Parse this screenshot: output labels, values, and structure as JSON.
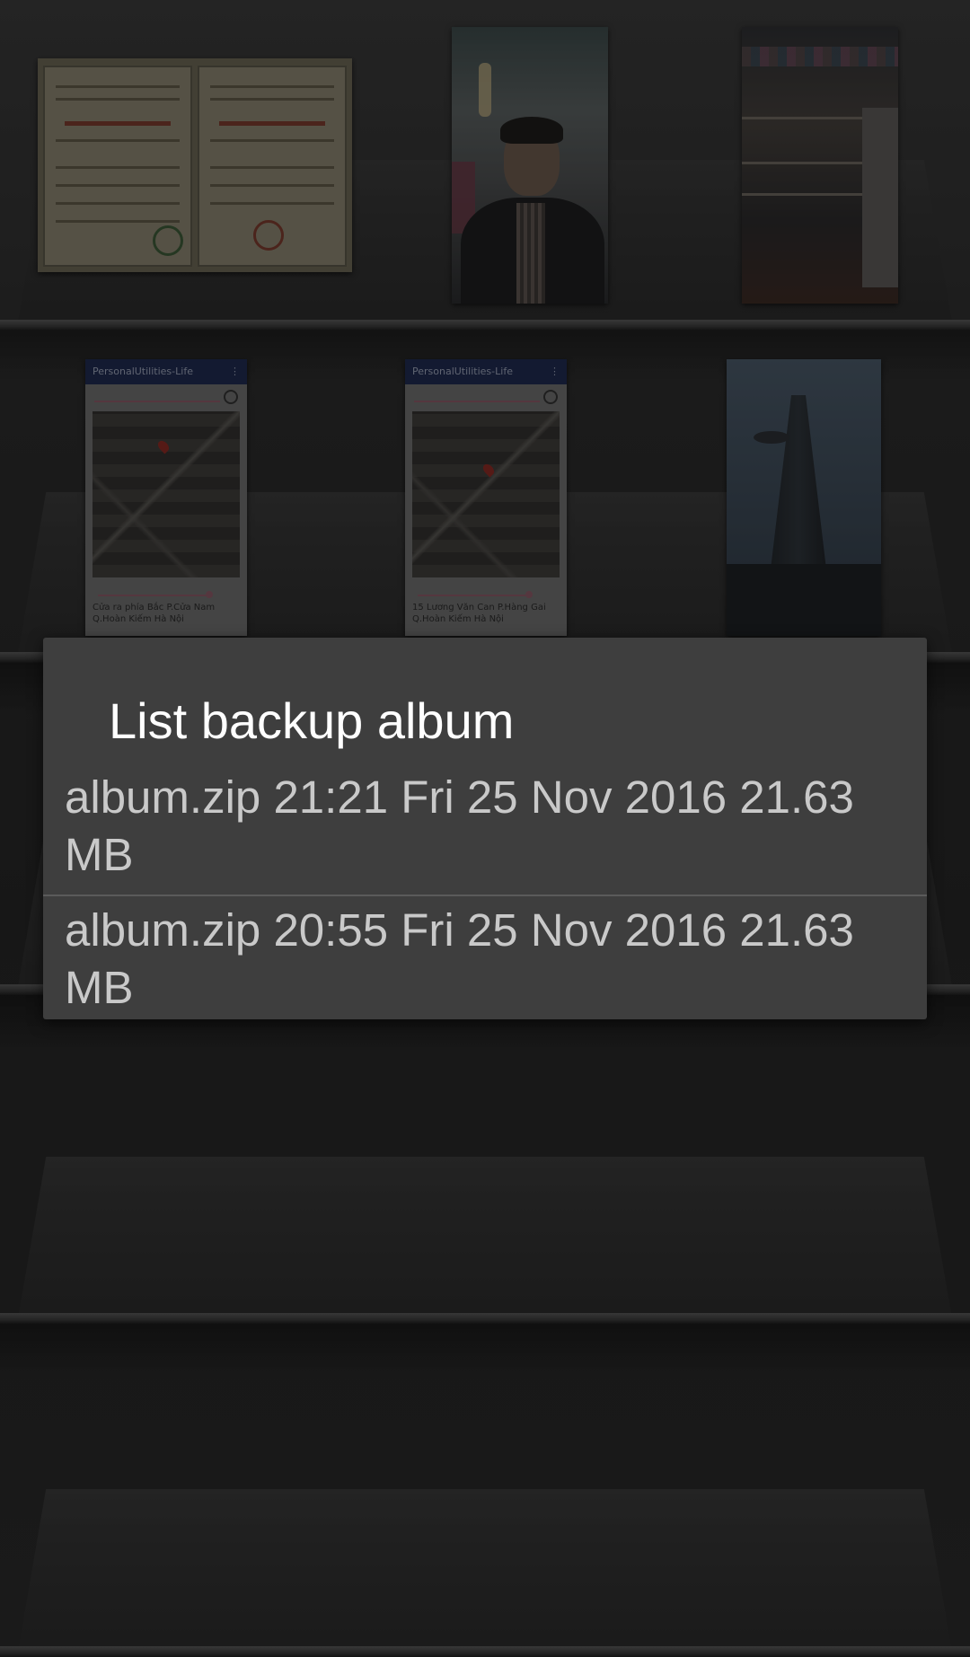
{
  "background": {
    "thumbnails": [
      {
        "name": "certificate-photo"
      },
      {
        "name": "portrait-photo"
      },
      {
        "name": "atrium-photo"
      },
      {
        "name": "map-screenshot-1",
        "app_bar": "PersonalUtilities-Life",
        "caption": "Cửa ra phía Bắc P.Cửa Nam Q.Hoàn Kiếm Hà Nội"
      },
      {
        "name": "map-screenshot-2",
        "app_bar": "PersonalUtilities-Life",
        "caption": "15 Lương Văn Can P.Hàng Gai Q.Hoàn Kiếm Hà Nội"
      },
      {
        "name": "tower-photo"
      }
    ]
  },
  "dialog": {
    "title": "List backup album",
    "items": [
      {
        "label": "album.zip 21:21 Fri 25 Nov 2016 21.63 MB"
      },
      {
        "label": "album.zip 20:55 Fri 25 Nov 2016 21.63 MB"
      }
    ]
  },
  "colors": {
    "dialog_bg": "#3e3e3e",
    "dialog_title": "#ffffff",
    "dialog_item_text": "#c9c9c9",
    "divider": "#5a5a5a"
  }
}
